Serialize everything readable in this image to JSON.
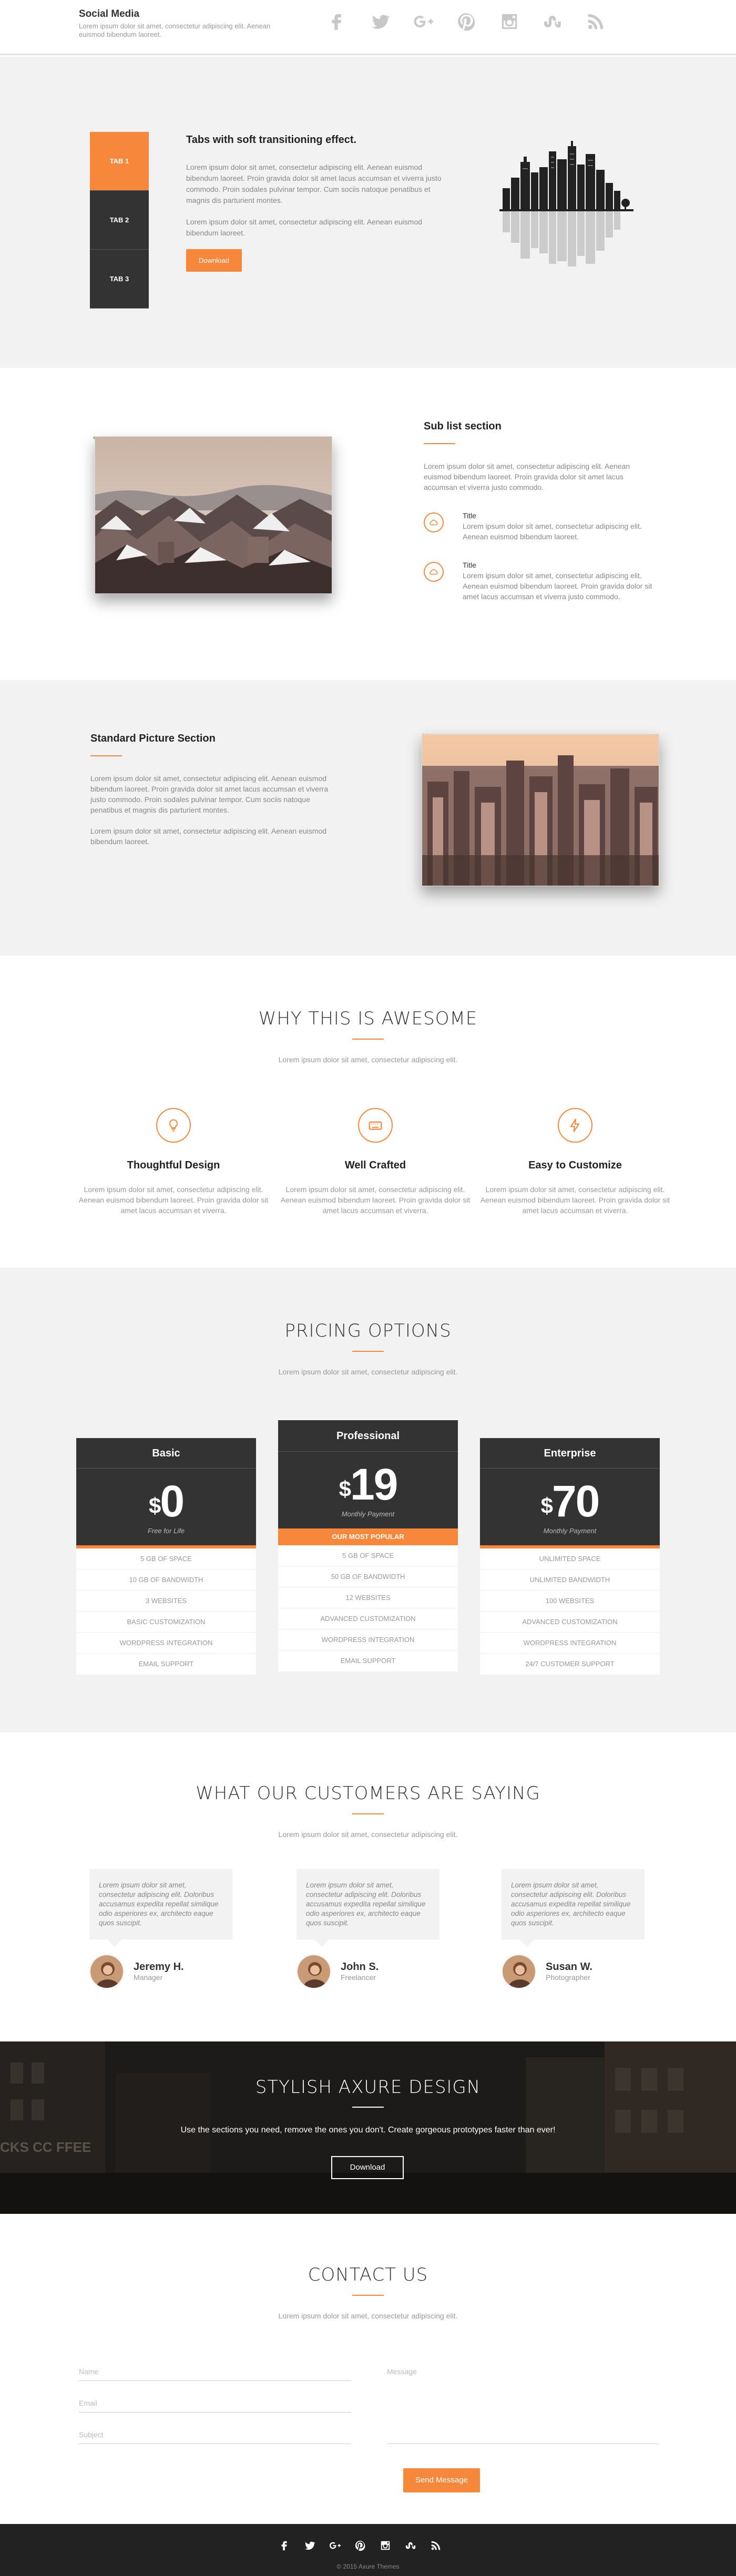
{
  "header": {
    "brand": "Social Media",
    "tagline": "Lorem ipsum dolor sit amet, consectetur adipiscing elit. Aenean euismod bibendum laoreet.",
    "social_icons": [
      "facebook-icon",
      "twitter-icon",
      "google-plus-icon",
      "pinterest-icon",
      "instagram-icon",
      "stumbleupon-icon",
      "rss-icon"
    ]
  },
  "tabs": {
    "items": [
      "TAB 1",
      "TAB 2",
      "TAB 3"
    ],
    "heading": "Tabs with soft transitioning effect.",
    "p1": "Lorem ipsum dolor sit amet, consectetur adipiscing elit. Aenean euismod bibendum laoreet. Proin gravida dolor sit amet lacus accumsan et viverra justo commodo. Proin sodales pulvinar tempor. Cum sociis natoque penatibus et magnis dis parturient montes.",
    "p2": "Lorem ipsum dolor sit amet, consectetur adipiscing elit. Aenean euismod bibendum laoreet.",
    "button": "Download"
  },
  "sublist": {
    "title": "Sub list section",
    "intro": "Lorem ipsum dolor sit amet, consectetur adipiscing elit. Aenean euismod bibendum laoreet. Proin gravida dolor sit amet lacus accumsan et viverra justo commodo.",
    "items": [
      {
        "title": "Title",
        "text": "Lorem ipsum dolor sit amet, consectetur adipiscing elit. Aenean euismod bibendum laoreet."
      },
      {
        "title": "Title",
        "text": "Lorem ipsum dolor sit amet, consectetur adipiscing elit. Aenean euismod bibendum laoreet. Proin gravida dolor sit amet lacus accumsan et viverra justo commodo."
      }
    ]
  },
  "standard": {
    "title": "Standard Picture Section",
    "p1": "Lorem ipsum dolor sit amet, consectetur adipiscing elit. Aenean euismod bibendum laoreet. Proin gravida dolor sit amet lacus accumsan et viverra justo commodo. Proin sodales pulvinar tempor. Cum sociis natoque penatibus et magnis dis parturient montes.",
    "p2": "Lorem ipsum dolor sit amet, consectetur adipiscing elit. Aenean euismod bibendum laoreet."
  },
  "features": {
    "title": "WHY THIS IS AWESOME",
    "subtitle": "Lorem ipsum dolor sit amet, consectetur adipiscing elit.",
    "items": [
      {
        "title": "Thoughtful Design",
        "text": "Lorem ipsum dolor sit amet, consectetur adipiscing elit. Aenean euismod bibendum laoreet. Proin gravida dolor sit amet lacus accumsan et viverra.",
        "icon": "lightbulb-icon"
      },
      {
        "title": "Well Crafted",
        "text": "Lorem ipsum dolor sit amet, consectetur adipiscing elit. Aenean euismod bibendum laoreet. Proin gravida dolor sit amet lacus accumsan et viverra.",
        "icon": "keyboard-icon"
      },
      {
        "title": "Easy to Customize",
        "text": "Lorem ipsum dolor sit amet, consectetur adipiscing elit. Aenean euismod bibendum laoreet. Proin gravida dolor sit amet lacus accumsan et viverra.",
        "icon": "lightning-icon"
      }
    ]
  },
  "pricing": {
    "title": "PRICING OPTIONS",
    "subtitle": "Lorem ipsum dolor sit amet, consectetur adipiscing elit.",
    "plans": [
      {
        "name": "Basic",
        "currency": "$",
        "price": "0",
        "note": "Free for Life",
        "features": [
          "5 GB OF SPACE",
          "10 GB OF BANDWIDTH",
          "3 WEBSITES",
          "BASIC CUSTOMIZATION",
          "WORDPRESS INTEGRATION",
          "EMAIL SUPPORT"
        ]
      },
      {
        "name": "Professional",
        "currency": "$",
        "price": "19",
        "note": "Monthly Payment",
        "badge": "OUR MOST POPULAR",
        "features": [
          "5 GB OF SPACE",
          "50 GB OF BANDWIDTH",
          "12 WEBSITES",
          "ADVANCED CUSTOMIZATION",
          "WORDPRESS INTEGRATION",
          "EMAIL SUPPORT"
        ]
      },
      {
        "name": "Enterprise",
        "currency": "$",
        "price": "70",
        "note": "Monthly Payment",
        "features": [
          "UNLIMITED SPACE",
          "UNLIMITED BANDWIDTH",
          "100 WEBSITES",
          "ADVANCED CUSTOMIZATION",
          "WORDPRESS INTEGRATION",
          "24/7 CUSTOMER SUPPORT"
        ]
      }
    ]
  },
  "testimonials": {
    "title": "WHAT OUR CUSTOMERS ARE SAYING",
    "subtitle": "Lorem ipsum dolor sit amet, consectetur adipiscing elit.",
    "quote": "Lorem ipsum dolor sit amet, consectetur adipiscing elit. Doloribus accusamus expedita repellat similique odio asperiores ex, architecto eaque quos suscipit.",
    "people": [
      {
        "name": "Jeremy H.",
        "role": "Manager"
      },
      {
        "name": "John S.",
        "role": "Freelancer"
      },
      {
        "name": "Susan W.",
        "role": "Photographer"
      }
    ]
  },
  "banner": {
    "title": "STYLISH AXURE DESIGN",
    "text": "Use the sections you need, remove the ones you don't.  Create gorgeous prototypes faster than ever!",
    "button": "Download"
  },
  "contact": {
    "title": "CONTACT US",
    "subtitle": "Lorem ipsum dolor sit amet, consectetur adipiscing elit.",
    "name_placeholder": "Name",
    "email_placeholder": "Email",
    "subject_placeholder": "Subject",
    "message_placeholder": "Message",
    "button": "Send Message"
  },
  "footer": {
    "copyright": "© 2015 Axure Themes"
  },
  "colors": {
    "accent": "#f7883b",
    "dark": "#333333",
    "light": "#f2f2f2"
  }
}
